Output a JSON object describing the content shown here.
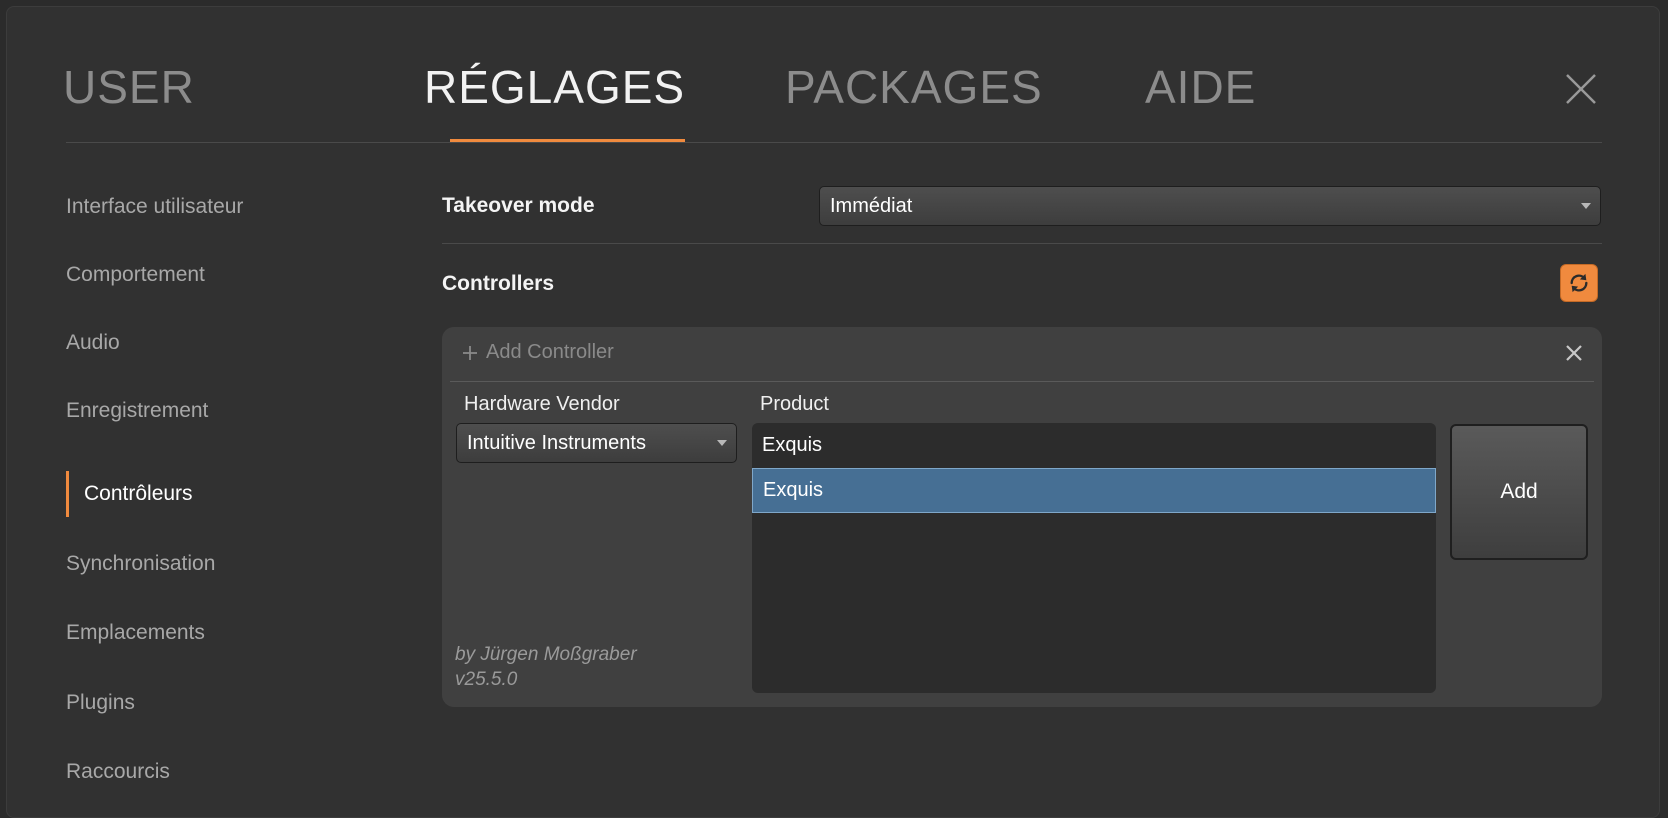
{
  "tabs": [
    {
      "label": "USER",
      "active": false
    },
    {
      "label": "RÉGLAGES",
      "active": true
    },
    {
      "label": "PACKAGES",
      "active": false
    },
    {
      "label": "AIDE",
      "active": false
    }
  ],
  "close_icon": "close-icon",
  "sidebar": {
    "items": [
      {
        "label": "Interface utilisateur"
      },
      {
        "label": "Comportement"
      },
      {
        "label": "Audio"
      },
      {
        "label": "Enregistrement"
      },
      {
        "label": "Contrôleurs",
        "active": true
      },
      {
        "label": "Synchronisation"
      },
      {
        "label": "Emplacements"
      },
      {
        "label": "Plugins"
      },
      {
        "label": "Raccourcis"
      }
    ]
  },
  "settings": {
    "takeover_label": "Takeover mode",
    "takeover_value": "Immédiat",
    "controllers_label": "Controllers",
    "refresh_icon": "refresh-icon"
  },
  "controller_panel": {
    "add_controller": "Add Controller",
    "vendor_label": "Hardware Vendor",
    "vendor_value": "Intuitive Instruments",
    "product_label": "Product",
    "products": [
      "Exquis",
      "Exquis"
    ],
    "selected_index": 1,
    "add_button": "Add",
    "author": "by Jürgen Moßgraber",
    "version": "v25.5.0"
  },
  "colors": {
    "accent": "#f08a3e",
    "selection": "#466f94",
    "background": "#313131"
  }
}
